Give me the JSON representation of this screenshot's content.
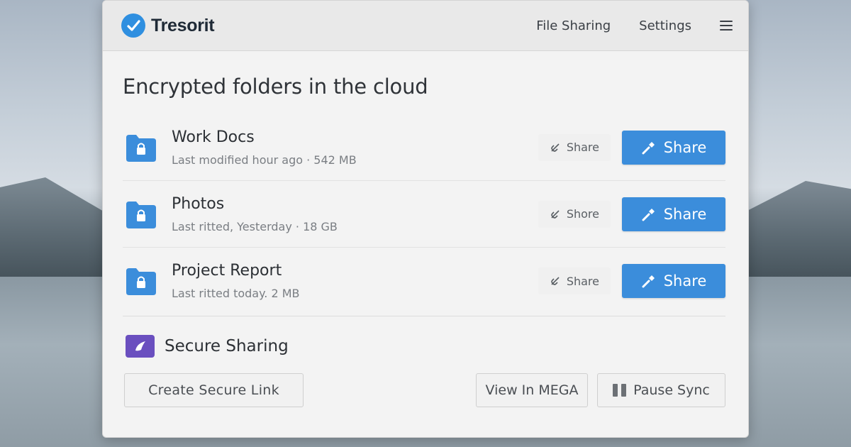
{
  "app": {
    "brand_name": "Tresorit",
    "accent_color": "#3b8ddb",
    "logo_icon": "tresorit-logo-icon"
  },
  "nav": {
    "items": [
      "File Sharing",
      "Settings"
    ],
    "menu_icon": "hamburger-menu-icon"
  },
  "main": {
    "heading": "Encrypted folders in the cloud",
    "folders": [
      {
        "name": "Work Docs",
        "meta": "Last modified hour ago · 542 MB",
        "secondary_action": "Share",
        "primary_action": "Share",
        "icon": "locked-folder-icon"
      },
      {
        "name": "Photos",
        "meta": "Last ritted, Yesterday  · 18 GB",
        "secondary_action": "Shore",
        "primary_action": "Share",
        "icon": "locked-folder-icon"
      },
      {
        "name": "Project Report",
        "meta": "Last ritted today. 2 MB",
        "secondary_action": "Share",
        "primary_action": "Share",
        "icon": "locked-folder-icon"
      }
    ]
  },
  "secure_sharing": {
    "title": "Secure Sharing",
    "icon": "secure-sharing-icon",
    "icon_color": "#6a4fbf"
  },
  "actions": {
    "create_link": "Create Secure Link",
    "view_mega": "View In MEGA",
    "pause_sync": "Pause Sync"
  }
}
